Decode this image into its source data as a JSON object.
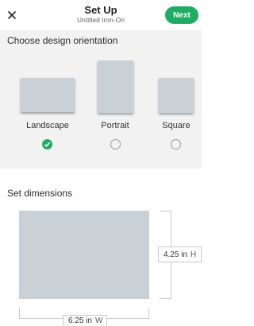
{
  "header": {
    "title": "Set Up",
    "subtitle": "Untitled Iron-On",
    "next_label": "Next",
    "close_icon": "close-icon",
    "accent_color": "#1fad62"
  },
  "orientation": {
    "heading": "Choose design orientation",
    "options": [
      {
        "label": "Landscape",
        "selected": true
      },
      {
        "label": "Portrait",
        "selected": false
      },
      {
        "label": "Square",
        "selected": false
      }
    ]
  },
  "dimensions": {
    "heading": "Set dimensions",
    "height": {
      "value": "4.25 in",
      "unit": "H"
    },
    "width": {
      "value": "6.25 in",
      "unit": "W"
    }
  }
}
